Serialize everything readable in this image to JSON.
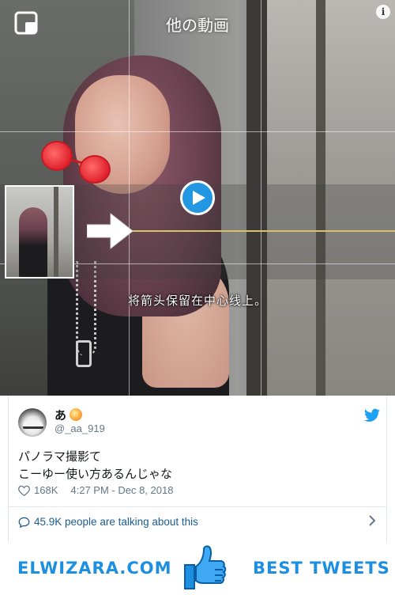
{
  "video": {
    "top_title": "他の動画",
    "subtitle": "将箭头保留在中心线上。",
    "info_glyph": "i",
    "icons": [
      "corner-expand-icon",
      "info-icon",
      "play-icon",
      "arrow-right-icon"
    ]
  },
  "tweet": {
    "display_name": "あ",
    "handle": "@_aa_919",
    "text_line1": "パノラマ撮影て",
    "text_line2": "こーゆー使い方あるんじゃな",
    "likes": "168K",
    "timestamp": "4:27 PM - Dec 8, 2018",
    "conversation": "45.9K people are talking about this",
    "accent": "#1da1f2"
  },
  "footer": {
    "site_name": "ELWIZARA.COM",
    "tagline": "BEST TWEETS",
    "brand_color": "#1d8fe0"
  }
}
